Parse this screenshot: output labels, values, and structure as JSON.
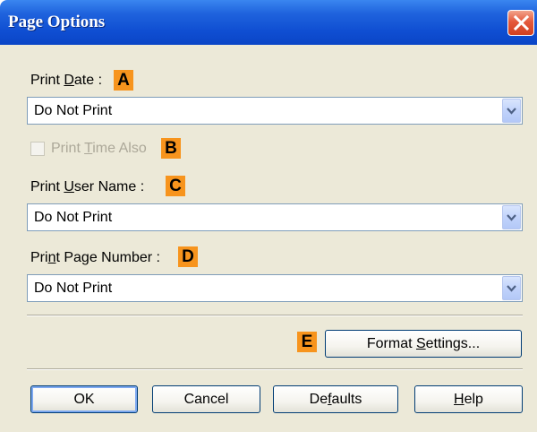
{
  "window": {
    "title": "Page Options"
  },
  "print_date": {
    "label_pre": "Print ",
    "label_acc": "D",
    "label_post": "ate :",
    "callout": "A",
    "value": "Do Not Print"
  },
  "print_time": {
    "label_pre": "Print ",
    "label_acc": "T",
    "label_post": "ime Also",
    "callout": "B",
    "checked": false,
    "enabled": false
  },
  "print_user": {
    "label_pre": "Print ",
    "label_acc": "U",
    "label_post": "ser Name :",
    "callout": "C",
    "value": "Do Not Print"
  },
  "print_page": {
    "label_pre": "Pri",
    "label_acc": "n",
    "label_post": "t Page Number :",
    "callout": "D",
    "value": "Do Not Print"
  },
  "format": {
    "callout": "E",
    "label_pre": "Format ",
    "label_acc": "S",
    "label_post": "ettings..."
  },
  "buttons": {
    "ok": {
      "label": "OK"
    },
    "cancel": {
      "label": "Cancel"
    },
    "defaults": {
      "label_pre": "De",
      "label_acc": "f",
      "label_post": "aults"
    },
    "help": {
      "label_pre": "",
      "label_acc": "H",
      "label_post": "elp"
    }
  },
  "colors": {
    "titlebar": "#0a45c6",
    "client": "#ece9d8",
    "callout": "#f7941d",
    "close": "#d2401f"
  }
}
